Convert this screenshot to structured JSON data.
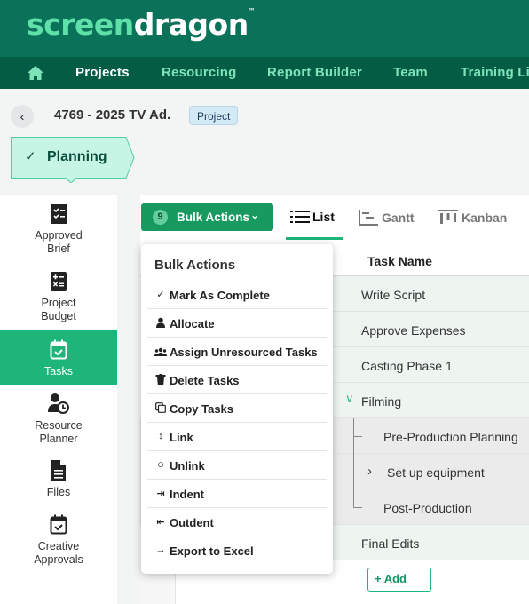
{
  "brand": {
    "part1": "screen",
    "part2": "dragon",
    "tm": "™"
  },
  "nav": {
    "items": [
      "Projects",
      "Resourcing",
      "Report Builder",
      "Team",
      "Training Li"
    ]
  },
  "project": {
    "title": "4769 - 2025 TV Ad.",
    "badge": "Project",
    "stage": "Planning"
  },
  "sidebar": {
    "items": [
      {
        "label": "Approved\nBrief",
        "icon": "approved-brief-icon"
      },
      {
        "label": "Project\nBudget",
        "icon": "calculator-icon"
      },
      {
        "label": "Tasks",
        "icon": "calendar-check-icon"
      },
      {
        "label": "Resource\nPlanner",
        "icon": "resource-planner-icon"
      },
      {
        "label": "Files",
        "icon": "file-icon"
      },
      {
        "label": "Creative\nApprovals",
        "icon": "calendar-check-icon"
      }
    ]
  },
  "toolbar": {
    "bulk_count": "9",
    "bulk_label": "Bulk Actions",
    "views": [
      "List",
      "Gantt",
      "Kanban"
    ]
  },
  "table": {
    "header": "Task Name",
    "rows": [
      "Write Script",
      "Approve Expenses",
      "Casting Phase 1",
      "Filming",
      "Pre-Production Planning",
      "Set up equipment",
      "Post-Production",
      "Final Edits"
    ],
    "add_label": "+ Add"
  },
  "bulk_menu": {
    "title": "Bulk Actions",
    "items": [
      {
        "label": "Mark As Complete",
        "icon": "check-icon"
      },
      {
        "label": "Allocate",
        "icon": "person-icon"
      },
      {
        "label": "Assign Unresourced Tasks",
        "icon": "group-icon"
      },
      {
        "label": "Delete Tasks",
        "icon": "trash-icon"
      },
      {
        "label": "Copy Tasks",
        "icon": "copy-icon"
      },
      {
        "label": "Link",
        "icon": "link-icon"
      },
      {
        "label": "Unlink",
        "icon": "circle-icon"
      },
      {
        "label": "Indent",
        "icon": "indent-icon"
      },
      {
        "label": "Outdent",
        "icon": "outdent-icon"
      },
      {
        "label": "Export to Excel",
        "icon": "arrow-right-icon"
      }
    ]
  },
  "colors": {
    "header": "#0a7258",
    "nav": "#055c45",
    "accent": "#1eb57a",
    "stage": "#c7f5e5"
  }
}
